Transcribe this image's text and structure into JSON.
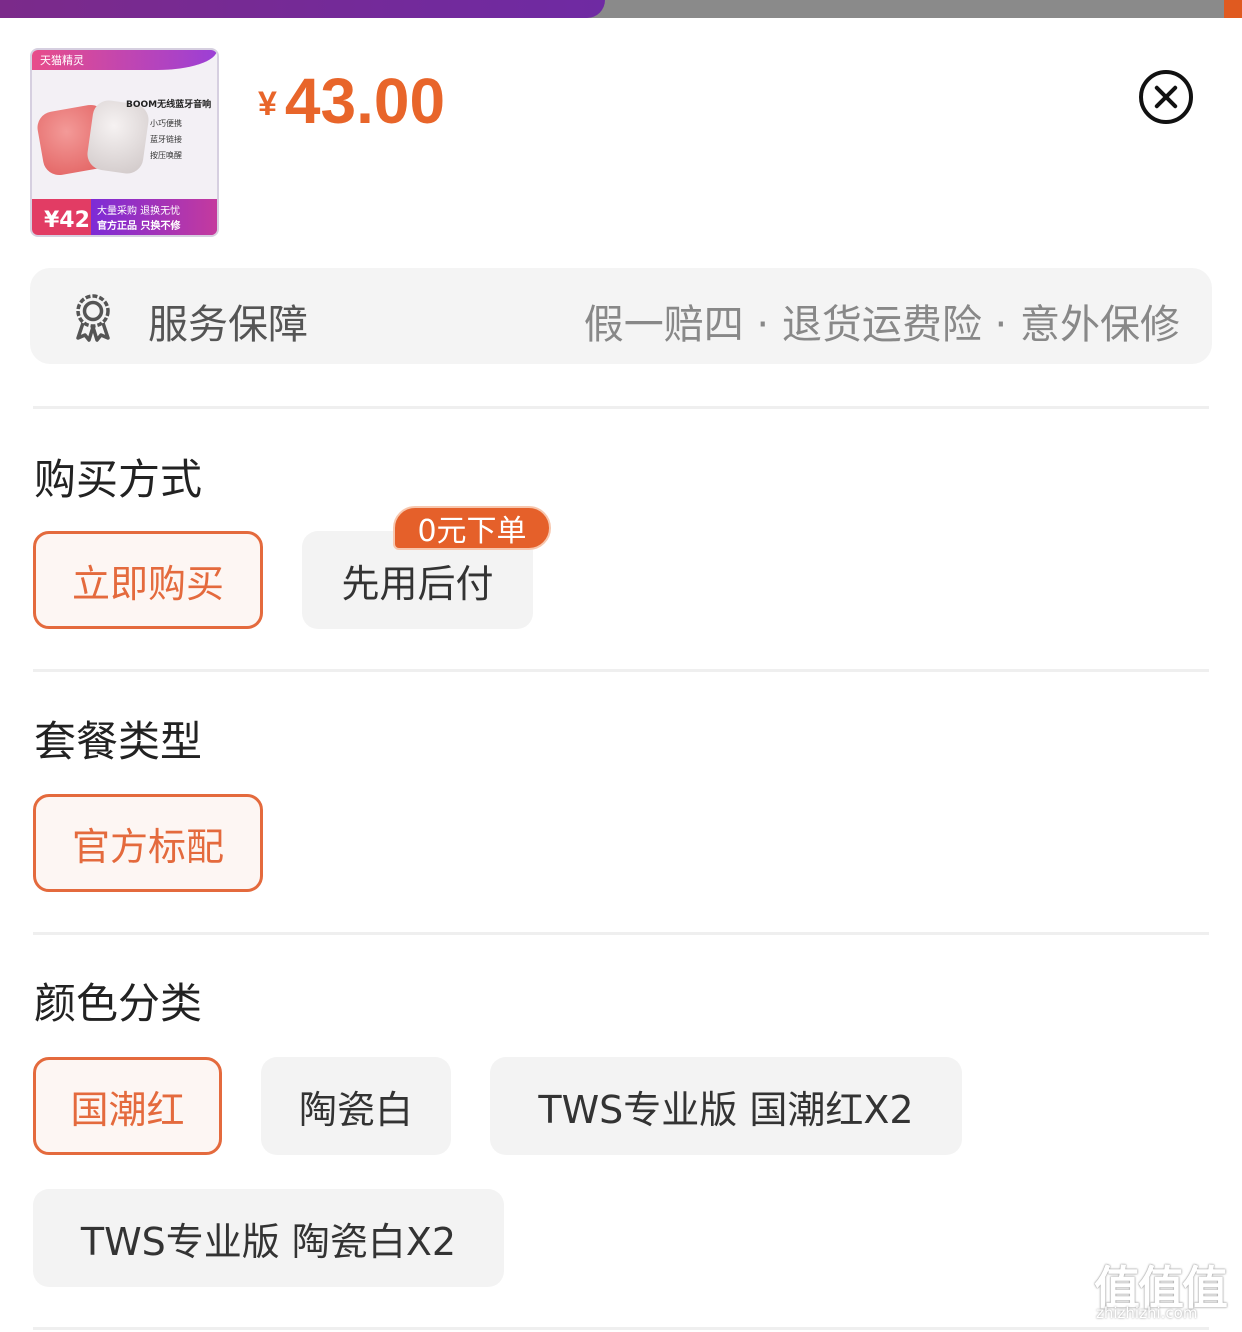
{
  "product": {
    "price_currency": "¥",
    "price_value": "43.00",
    "thumbnail": {
      "brand": "天猫精灵",
      "title": "BOOM无线蓝牙音响",
      "lines": [
        "小巧便携",
        "蓝牙链接",
        "按压唤醒"
      ],
      "promo_line1": "大量采购 退换无忧",
      "promo_line2": "官方正品 只换不修",
      "price_badge": "¥42"
    }
  },
  "service": {
    "icon": "award-ribbon-icon",
    "title": "服务保障",
    "detail": "假一赔四 · 退货运费险 · 意外保修"
  },
  "purchase_method": {
    "title": "购买方式",
    "options": [
      {
        "label": "立即购买",
        "selected": true
      },
      {
        "label": "先用后付",
        "selected": false,
        "badge": "0元下单"
      }
    ]
  },
  "package_type": {
    "title": "套餐类型",
    "options": [
      {
        "label": "官方标配",
        "selected": true
      }
    ]
  },
  "color_category": {
    "title": "颜色分类",
    "options": [
      {
        "label": "国潮红",
        "selected": true
      },
      {
        "label": "陶瓷白",
        "selected": false
      },
      {
        "label": "TWS专业版 国潮红X2",
        "selected": false
      },
      {
        "label": "TWS专业版 陶瓷白X2",
        "selected": false
      }
    ]
  },
  "watermark": {
    "logo": "值值值",
    "url": "zhizhizhi.com"
  },
  "colors": {
    "accent": "#e46a3d",
    "price": "#e8652a",
    "badge": "#e5602a"
  }
}
